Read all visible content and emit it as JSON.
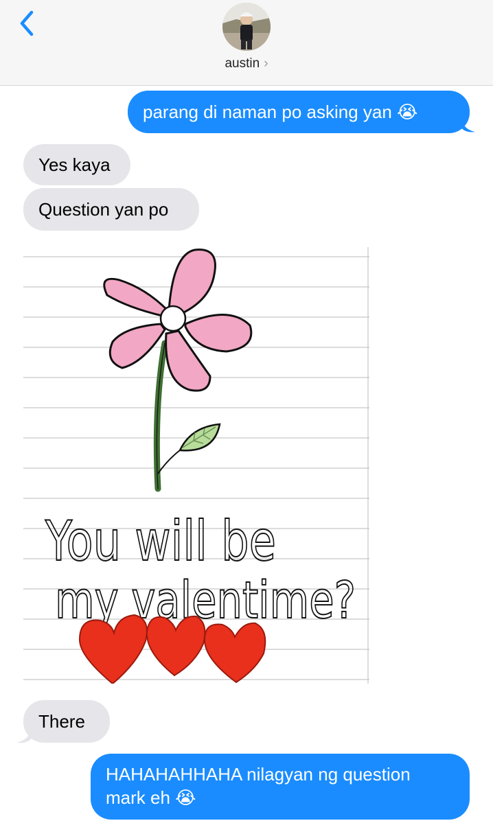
{
  "header": {
    "contact_name": "austin",
    "chevron": "›",
    "back_icon": "chevron-left-icon",
    "accent": "#1a8cff"
  },
  "messages": [
    {
      "side": "out",
      "text": "parang di naman po asking yan 😭"
    },
    {
      "side": "in",
      "text": "Yes kaya"
    },
    {
      "side": "in",
      "text": "Question yan po"
    },
    {
      "side": "in",
      "type": "image",
      "handwriting": [
        "You will be",
        "my valentime?"
      ]
    },
    {
      "side": "in",
      "text": "There"
    },
    {
      "side": "out",
      "lines": [
        "HAHAHAHHAHA nilagyan ng question",
        "mark eh 😭"
      ]
    }
  ],
  "colors": {
    "outgoing_bubble": "#1a8cff",
    "incoming_bubble": "#e5e5ea",
    "flower_petal": "#f2a7c4",
    "stem": "#3f6f32",
    "leaf": "#b8dc9a",
    "heart": "#e8301c"
  }
}
